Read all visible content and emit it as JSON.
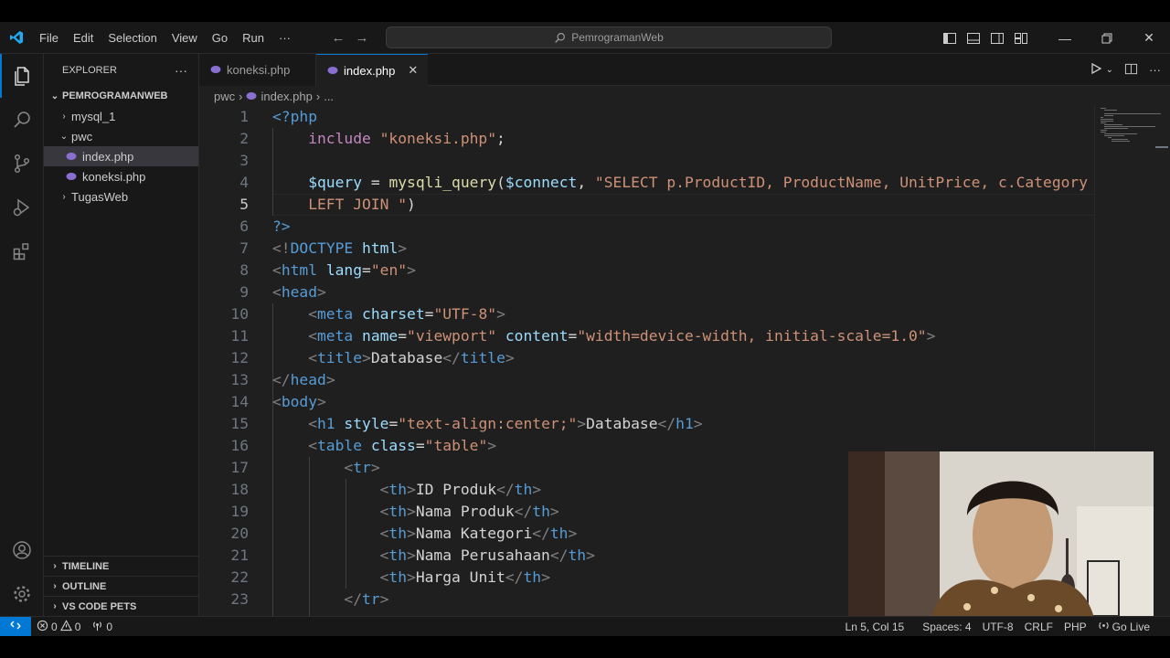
{
  "menu": [
    "File",
    "Edit",
    "Selection",
    "View",
    "Go",
    "Run",
    "···"
  ],
  "search": {
    "text": "PemrogramanWeb"
  },
  "sidebar": {
    "title": "EXPLORER",
    "more": "···",
    "root": "PEMROGRAMANWEB",
    "items": [
      {
        "label": "mysql_1"
      },
      {
        "label": "pwc"
      },
      {
        "label": "index.php"
      },
      {
        "label": "koneksi.php"
      },
      {
        "label": "TugasWeb"
      }
    ],
    "panels": [
      "TIMELINE",
      "OUTLINE",
      "VS CODE PETS"
    ]
  },
  "tabs": [
    {
      "label": "koneksi.php"
    },
    {
      "label": "index.php"
    }
  ],
  "breadcrumb": {
    "folder": "pwc",
    "file": "index.php",
    "more": "..."
  },
  "editor": {
    "line_numbers": [
      "1",
      "2",
      "3",
      "4",
      "5",
      "6",
      "7",
      "8",
      "9",
      "10",
      "11",
      "12",
      "13",
      "14",
      "15",
      "16",
      "17",
      "18",
      "19",
      "20",
      "21",
      "22",
      "23"
    ],
    "current_line": 5
  },
  "status": {
    "errors": "0",
    "warnings": "0",
    "ports": "0",
    "position": "Ln 5, Col 15",
    "spaces": "Spaces: 4",
    "encoding": "UTF-8",
    "eol": "CRLF",
    "language": "PHP",
    "golive": "Go Live"
  },
  "colors": {
    "accent": "#0078d4",
    "php_icon": "#8a6fd1"
  }
}
